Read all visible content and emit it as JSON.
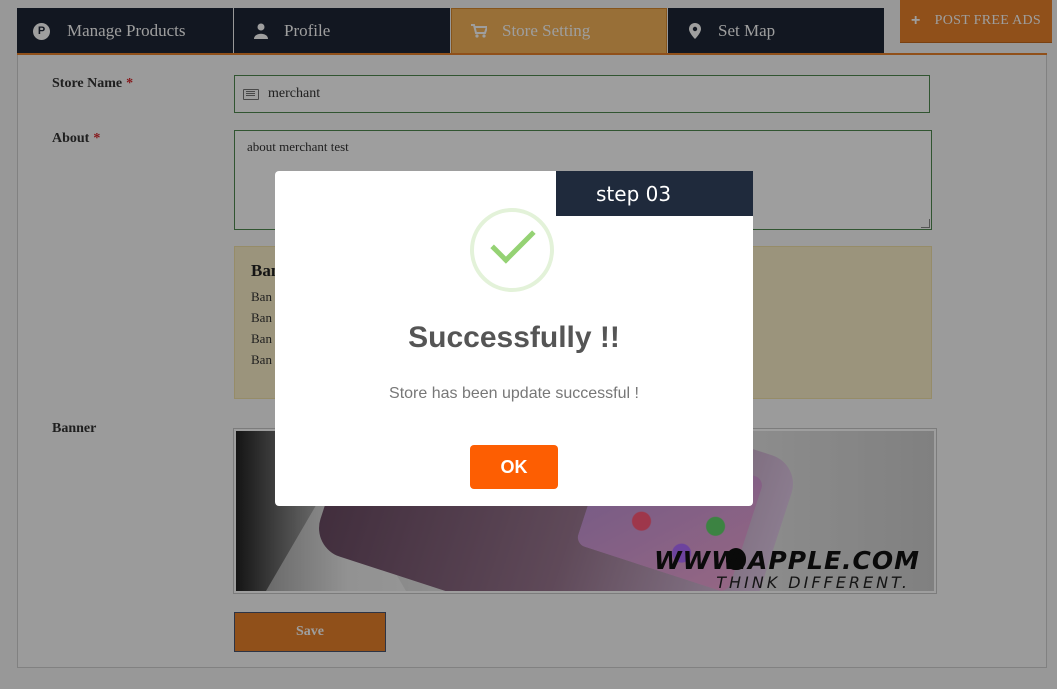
{
  "tabs": [
    {
      "label": "Manage Products",
      "icon": "p-circle-icon",
      "active": false
    },
    {
      "label": "Profile",
      "icon": "user-icon",
      "active": false
    },
    {
      "label": "Store Setting",
      "icon": "cart-icon",
      "active": true
    },
    {
      "label": "Set Map",
      "icon": "map-pin-icon",
      "active": false
    }
  ],
  "post_ads": {
    "label": "POST FREE ADS",
    "icon": "plus-icon"
  },
  "form": {
    "store_name_label": "Store Name",
    "required_mark": "*",
    "store_name_value": "merchant",
    "about_label": "About",
    "about_value": "about merchant test",
    "banner_info_heading": "Ban",
    "banner_info_lines": [
      "Ban",
      "Ban",
      "Ban",
      "Ban"
    ],
    "banner_label": "Banner",
    "banner_image_text": {
      "url": "WWW.APPLE.COM",
      "tagline": "THINK DIFFERENT."
    },
    "save_label": "Save"
  },
  "modal": {
    "step_label": "step 03",
    "title": "Successfully !!",
    "message": "Store has been update successful !",
    "ok_label": "OK"
  },
  "colors": {
    "nav_dark": "#1d2636",
    "accent_orange": "#e8822a",
    "ok_orange": "#fd5e02",
    "success_green": "#95d274",
    "step_bg": "#1f2a3c"
  }
}
